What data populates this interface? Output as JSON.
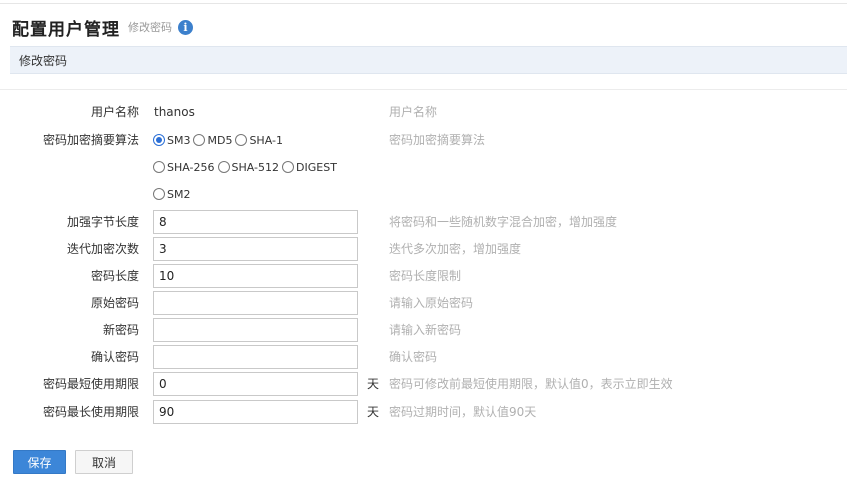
{
  "header": {
    "title": "配置用户管理",
    "subtitle": "修改密码",
    "info_icon": "i"
  },
  "section": {
    "title": "修改密码"
  },
  "form": {
    "username": {
      "label": "用户名称",
      "value": "thanos",
      "hint": "用户名称"
    },
    "algorithm": {
      "label": "密码加密摘要算法",
      "hint": "密码加密摘要算法",
      "options": [
        "SM3",
        "MD5",
        "SHA-1",
        "SHA-256",
        "SHA-512",
        "DIGEST",
        "SM2"
      ],
      "selected": "SM3"
    },
    "salt_length": {
      "label": "加强字节长度",
      "value": "8",
      "hint": "将密码和一些随机数字混合加密，增加强度"
    },
    "iterations": {
      "label": "迭代加密次数",
      "value": "3",
      "hint": "迭代多次加密，增加强度"
    },
    "password_length": {
      "label": "密码长度",
      "value": "10",
      "hint": "密码长度限制"
    },
    "old_password": {
      "label": "原始密码",
      "value": "",
      "hint": "请输入原始密码"
    },
    "new_password": {
      "label": "新密码",
      "value": "",
      "hint": "请输入新密码"
    },
    "confirm_password": {
      "label": "确认密码",
      "value": "",
      "hint": "确认密码"
    },
    "min_period": {
      "label": "密码最短使用期限",
      "value": "0",
      "unit": "天",
      "hint": "密码可修改前最短使用期限，默认值0，表示立即生效"
    },
    "max_period": {
      "label": "密码最长使用期限",
      "value": "90",
      "unit": "天",
      "hint": "密码过期时间，默认值90天"
    }
  },
  "buttons": {
    "save": "保存",
    "cancel": "取消"
  },
  "colors": {
    "accent": "#3c86d8",
    "section_bg": "#edf2f9",
    "hint": "#b0b0b0"
  }
}
